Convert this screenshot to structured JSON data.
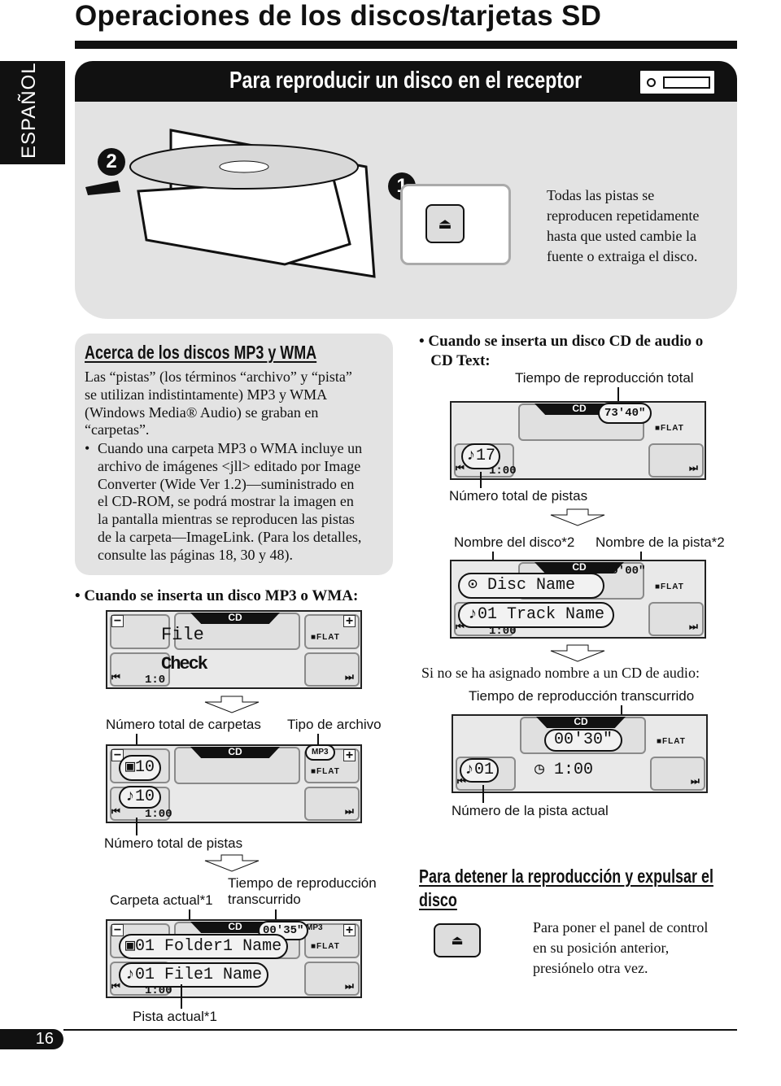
{
  "page": {
    "title": "Operaciones de los discos/tarjetas SD",
    "language_tab": "ESPAÑOL",
    "page_number": "16"
  },
  "section1": {
    "heading": "Para reproducir un disco en el receptor",
    "step1": "1",
    "step2": "2",
    "note_lines": [
      "Todas las pistas se",
      "reproducen repetidamente",
      "hasta que usted cambie la",
      "fuente o extraiga el disco."
    ]
  },
  "mp3box": {
    "heading": "Acerca de los discos MP3 y WMA",
    "lines": [
      "Las “pistas” (los términos “archivo” y “pista”",
      "se utilizan indistintamente) MP3 y WMA",
      "(Windows Media® Audio) se graban en",
      "“carpetas”."
    ],
    "bullet_lines": [
      "Cuando una carpeta MP3 o WMA incluye un",
      "archivo de imágenes <jll> editado por Image",
      "Converter (Wide Ver 1.2)—suministrado en",
      "el CD-ROM, se podrá mostrar la imagen en",
      "la pantalla mientras se reproducen las pistas",
      "de la carpeta—ImageLink. (Para los detalles,",
      "consulte las páginas 18, 30 y 48)."
    ]
  },
  "display": {
    "cd": "CD",
    "minus": "−",
    "plus": "+",
    "flat": "■FLAT",
    "prev": "⏮",
    "next": "⏭",
    "mp3": "MP3"
  },
  "mp3_section": {
    "bullet": "Cuando se inserta un disco MP3 o WMA:",
    "p1": {
      "line1": "File",
      "line2": "Check",
      "time": "1:0"
    },
    "label_folders": "Número total de carpetas",
    "label_filetype": "Tipo de archivo",
    "p2": {
      "folders": "▣10",
      "tracks": "♪10",
      "time": "1:00"
    },
    "label_tracks": "Número total de pistas",
    "label_elapsed_1": "Tiempo de reproducción",
    "label_elapsed_2": "transcurrido",
    "label_folder": "Carpeta actual*1",
    "p3": {
      "elapsed": "00'35\"",
      "folder": "▣01 Folder1 Name",
      "file": "♪01 File1 Name",
      "time": "1:00"
    },
    "label_track": "Pista actual*1"
  },
  "cd_section": {
    "bullet_1": "Cuando se inserta un disco CD de audio o",
    "bullet_2": "CD Text:",
    "label_total_time": "Tiempo de reproducción total",
    "p1": {
      "total_time": "73'40\"",
      "tracks": "♪17",
      "time": "1:00"
    },
    "label_total_tracks": "Número total de pistas",
    "label_disc": "Nombre del disco*2",
    "label_track": "Nombre de la pista*2",
    "p2": {
      "elapsed": "00'00\"",
      "disc": "⊙  Disc Name",
      "track": "♪01 Track Name",
      "time": "1:00"
    },
    "no_name": "Si no se ha asignado nombre a un CD de audio:",
    "label_elapsed": "Tiempo de reproducción transcurrido",
    "p3": {
      "elapsed": "00'30\"",
      "track": "♪01",
      "clock": "◷ 1:00"
    },
    "label_current": "Número de la pista actual"
  },
  "stop": {
    "heading_1": "Para detener la reproducción y expulsar el",
    "heading_2": "disco",
    "lines": [
      "Para poner el panel de control",
      "en su posición anterior,",
      "presiónelo otra vez."
    ]
  }
}
